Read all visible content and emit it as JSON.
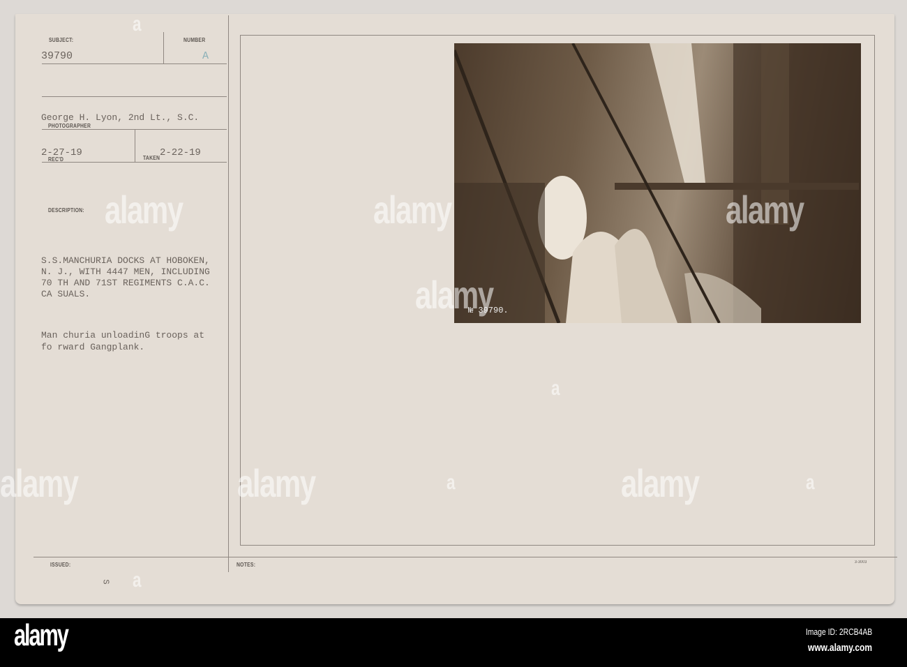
{
  "card": {
    "subject_label": "SUBJECT:",
    "subject_value": "39790",
    "number_label": "NUMBER",
    "number_value": "A",
    "photographer_value": "George H. Lyon, 2nd Lt., S.C.",
    "photographer_label": "PHOTOGRAPHER",
    "received_value": "2-27-19",
    "received_label": "REC'D",
    "taken_label": "TAKEN",
    "taken_value": "2-22-19",
    "description_label": "DESCRIPTION:",
    "description_lines": [
      "S.S.MANCHURIA DOCKS AT HOBOKEN,",
      "N. J., WITH 4447 MEN, INCLUDING",
      "70 TH AND 71ST REGIMENTS C.A.C.",
      "CA SUALS."
    ],
    "caption_lines": [
      "Man churia unloadinG troops at",
      "fo rward Gangplank."
    ],
    "issued_label": "ISSUED:",
    "issued_mark": "S",
    "notes_label": "NOTES:",
    "form_code": "3-3003"
  },
  "photo": {
    "negative_number": "№ 39790."
  },
  "watermark": {
    "brand": "alamy",
    "letter": "a"
  },
  "footer": {
    "logo": "alamy",
    "image_id": "Image ID: 2RCB4AB",
    "website": "www.alamy.com"
  }
}
